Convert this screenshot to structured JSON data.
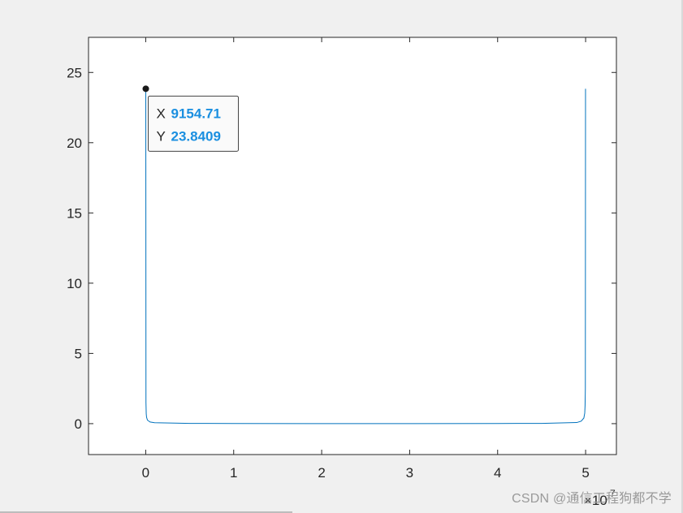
{
  "chart_data": {
    "type": "line",
    "xlim": [
      -0.65,
      5.35
    ],
    "ylim": [
      -2.2,
      27.5
    ],
    "x_scale_exponent": "7",
    "x_ticks": [
      0,
      1,
      2,
      3,
      4,
      5
    ],
    "y_ticks": [
      0,
      5,
      10,
      15,
      20,
      25
    ],
    "x_tick_labels": [
      "0",
      "1",
      "2",
      "3",
      "4",
      "5"
    ],
    "y_tick_labels": [
      "0",
      "5",
      "10",
      "15",
      "20",
      "25"
    ],
    "exponent_label": "×10",
    "grid": false,
    "series": [
      {
        "color": "#0072bd",
        "x": [
          0.000915471,
          0.003,
          0.006,
          0.01,
          0.02,
          0.05,
          0.1,
          0.5,
          1,
          2,
          2.5,
          3,
          4,
          4.5,
          4.9,
          4.95,
          4.98,
          4.99,
          4.994,
          4.997,
          4.999
        ],
        "y": [
          23.8409,
          1.5,
          0.7,
          0.45,
          0.25,
          0.12,
          0.07,
          0.02,
          0.01,
          0.005,
          0.004,
          0.005,
          0.01,
          0.02,
          0.08,
          0.18,
          0.4,
          0.75,
          1.3,
          2.5,
          23.8409
        ]
      }
    ],
    "datatip": {
      "x_key": "X",
      "x_value": "9154.71",
      "y_key": "Y",
      "y_value": "23.8409"
    }
  },
  "watermark": "CSDN @通信工程狗都不学"
}
